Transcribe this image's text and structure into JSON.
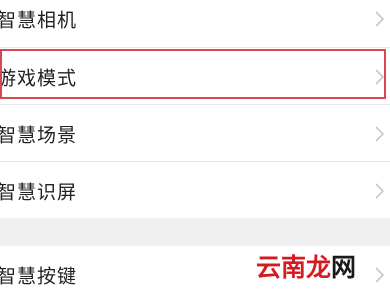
{
  "settings": {
    "items": [
      {
        "label": "智慧相机"
      },
      {
        "label": "游戏模式"
      },
      {
        "label": "智慧场景"
      },
      {
        "label": "智慧识屏"
      },
      {
        "label": "智慧按键"
      }
    ]
  },
  "watermark": {
    "part1": "云南",
    "part2": "龙",
    "part3": "网"
  },
  "colors": {
    "highlight_border": "#d9484f",
    "background": "#f7f7f7",
    "watermark_red": "#d71920"
  }
}
